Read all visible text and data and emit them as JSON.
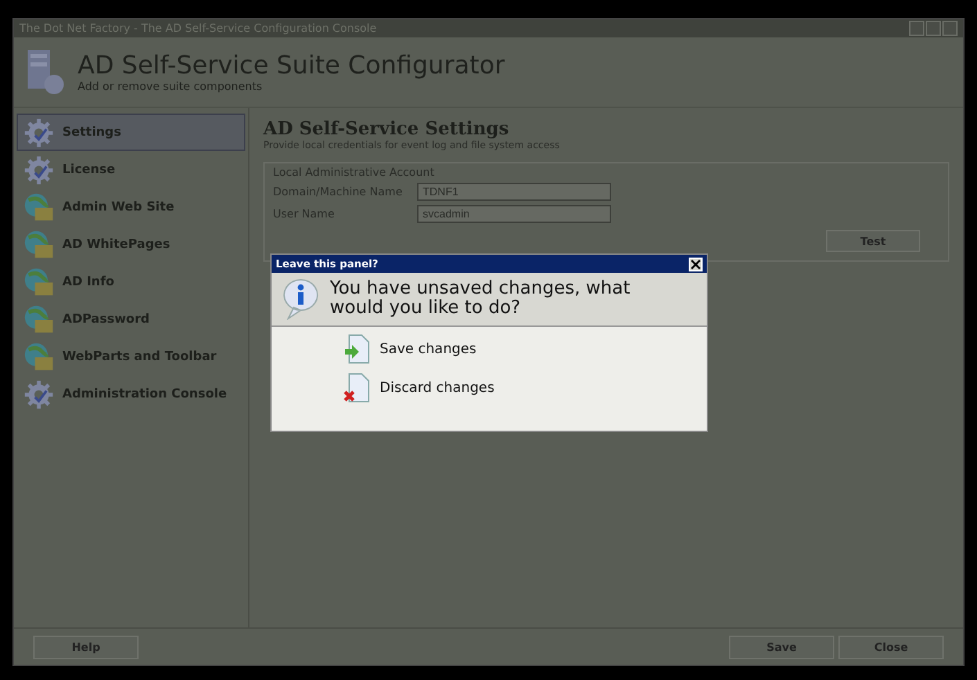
{
  "window": {
    "title": "The Dot Net Factory - The AD Self-Service Configuration Console"
  },
  "header": {
    "title": "AD Self-Service Suite Configurator",
    "subtitle": "Add or remove suite components"
  },
  "sidebar": {
    "items": [
      {
        "label": "Settings",
        "kind": "gear",
        "selected": true
      },
      {
        "label": "License",
        "kind": "gear",
        "selected": false
      },
      {
        "label": "Admin Web Site",
        "kind": "globe",
        "selected": false
      },
      {
        "label": "AD WhitePages",
        "kind": "globe",
        "selected": false
      },
      {
        "label": "AD Info",
        "kind": "globe",
        "selected": false
      },
      {
        "label": "ADPassword",
        "kind": "globe",
        "selected": false
      },
      {
        "label": "WebParts and Toolbar",
        "kind": "globe",
        "selected": false
      },
      {
        "label": "Administration Console",
        "kind": "gear",
        "selected": false
      }
    ]
  },
  "panel": {
    "title": "AD Self-Service Settings",
    "subtitle": "Provide local credentials for event log and file system access",
    "group": {
      "title": "Local Administrative Account",
      "fields": [
        {
          "label": "Domain/Machine Name",
          "value": "TDNF1"
        },
        {
          "label": "User Name",
          "value": "svcadmin"
        }
      ]
    },
    "test_button": "Test"
  },
  "dialog": {
    "title": "Leave this panel?",
    "message": "You have unsaved changes, what would you like to do?",
    "options": [
      {
        "label": "Save changes",
        "kind": "save"
      },
      {
        "label": "Discard changes",
        "kind": "discard"
      }
    ]
  },
  "footer": {
    "help": "Help",
    "save": "Save",
    "close": "Close"
  }
}
